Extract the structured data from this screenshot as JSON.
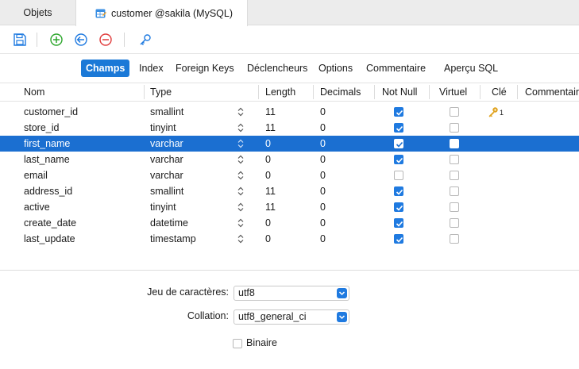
{
  "tabs": {
    "objets": "Objets",
    "customer": "customer @sakila (MySQL)"
  },
  "subtabs": [
    {
      "label": "Champs",
      "active": true
    },
    {
      "label": "Index"
    },
    {
      "label": "Foreign Keys"
    },
    {
      "label": "Déclencheurs"
    },
    {
      "label": "Options"
    },
    {
      "label": "Commentaire"
    },
    {
      "label": "Aperçu SQL"
    }
  ],
  "columns": {
    "nom": "Nom",
    "type": "Type",
    "length": "Length",
    "decimals": "Decimals",
    "not_null": "Not Null",
    "virtuel": "Virtuel",
    "cle": "Clé",
    "commentaire": "Commentaire"
  },
  "fields": [
    {
      "name": "customer_id",
      "type": "smallint",
      "length": "11",
      "decimals": "0",
      "not_null": true,
      "virtuel": false,
      "key": "1"
    },
    {
      "name": "store_id",
      "type": "tinyint",
      "length": "11",
      "decimals": "0",
      "not_null": true,
      "virtuel": false,
      "key": ""
    },
    {
      "name": "first_name",
      "type": "varchar",
      "length": "0",
      "decimals": "0",
      "not_null": true,
      "virtuel": false,
      "key": "",
      "selected": true
    },
    {
      "name": "last_name",
      "type": "varchar",
      "length": "0",
      "decimals": "0",
      "not_null": true,
      "virtuel": false,
      "key": ""
    },
    {
      "name": "email",
      "type": "varchar",
      "length": "0",
      "decimals": "0",
      "not_null": false,
      "virtuel": false,
      "key": ""
    },
    {
      "name": "address_id",
      "type": "smallint",
      "length": "11",
      "decimals": "0",
      "not_null": true,
      "virtuel": false,
      "key": ""
    },
    {
      "name": "active",
      "type": "tinyint",
      "length": "11",
      "decimals": "0",
      "not_null": true,
      "virtuel": false,
      "key": ""
    },
    {
      "name": "create_date",
      "type": "datetime",
      "length": "0",
      "decimals": "0",
      "not_null": true,
      "virtuel": false,
      "key": ""
    },
    {
      "name": "last_update",
      "type": "timestamp",
      "length": "0",
      "decimals": "0",
      "not_null": true,
      "virtuel": false,
      "key": ""
    }
  ],
  "bottom": {
    "charset_label": "Jeu de caractères:",
    "charset_value": "utf8",
    "collation_label": "Collation:",
    "collation_value": "utf8_general_ci",
    "binary_label": "Binaire",
    "binary_checked": false
  },
  "icons": {
    "save": "save-icon",
    "add": "add-field-icon",
    "insert": "insert-field-icon",
    "delete": "delete-field-icon",
    "primary_key": "key-icon"
  },
  "colors": {
    "accent": "#1b79d7",
    "selected_row": "#1b6fd1",
    "add_green": "#2aa52a",
    "delete_red": "#e03b3b",
    "key_gold": "#e0a31f"
  }
}
